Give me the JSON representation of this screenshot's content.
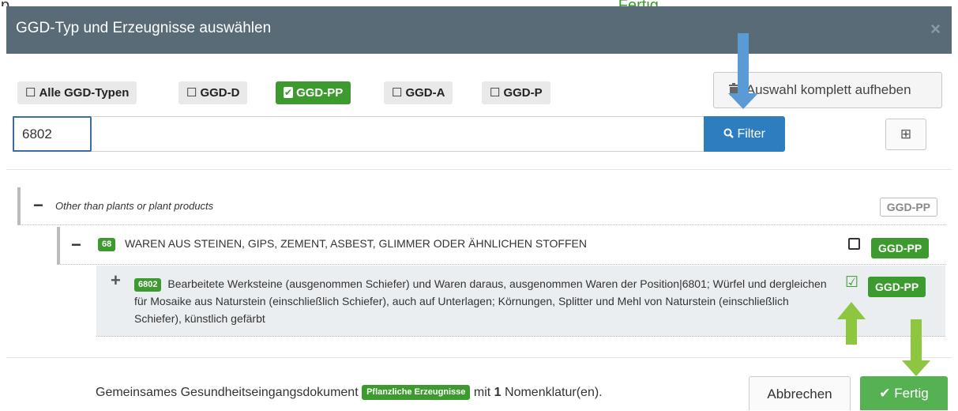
{
  "background_text": {
    "prefix": "p",
    "quote": "„",
    "green_word": "Fertig"
  },
  "dialog": {
    "title": "GGD-Typ und Erzeugnisse auswählen",
    "close_glyph": "×"
  },
  "type_filters": [
    {
      "label": "Alle GGD-Typen",
      "checked": false
    },
    {
      "label": "GGD-D",
      "checked": false
    },
    {
      "label": "GGD-PP",
      "checked": true
    },
    {
      "label": "GGD-A",
      "checked": false
    },
    {
      "label": "GGD-P",
      "checked": false
    }
  ],
  "checkbox_glyphs": {
    "unchecked": "☐",
    "checked": "✔"
  },
  "clear_selection": {
    "label": "Auswahl komplett aufheben",
    "icon": "trash-icon"
  },
  "filter": {
    "value": "6802",
    "button_label": "Filter",
    "icon": "search-icon",
    "expand_icon": "⊞"
  },
  "tree": {
    "level1": {
      "toggle": "−",
      "label": "Other than plants or plant products",
      "badge": "GGD-PP"
    },
    "level2": {
      "toggle": "−",
      "code": "68",
      "label": "WAREN AUS STEINEN, GIPS, ZEMENT, ASBEST, GLIMMER ODER ÄHNLICHEN STOFFEN",
      "badge": "GGD-PP",
      "checked": false
    },
    "level3": {
      "toggle": "+",
      "code": "6802",
      "label": "Bearbeitete Werksteine (ausgenommen Schiefer) und Waren daraus, ausgenommen Waren der Position|6801; Würfel und dergleichen für Mosaike aus Naturstein (einschließlich Schiefer), auch auf Unterlagen; Körnungen, Splitter und Mehl von Naturstein (einschließlich Schiefer), künstlich gefärbt",
      "badge": "GGD-PP",
      "checked": true,
      "check_glyph": "☑"
    }
  },
  "footer": {
    "prefix": "Gemeinsames Gesundheitseingangsdokument",
    "pill": "Pflanzliche Erzeugnisse",
    "mid": "mit",
    "count": "1",
    "suffix": "Nomenklatur(en).",
    "cancel_label": "Abbrechen",
    "done_label": "Fertig",
    "done_icon": "✔"
  },
  "colors": {
    "header": "#5a6b78",
    "green": "#3c9a2e",
    "blue": "#2e7dbf",
    "arrow_blue": "#5b9bd5",
    "arrow_green": "#8dc63f"
  }
}
